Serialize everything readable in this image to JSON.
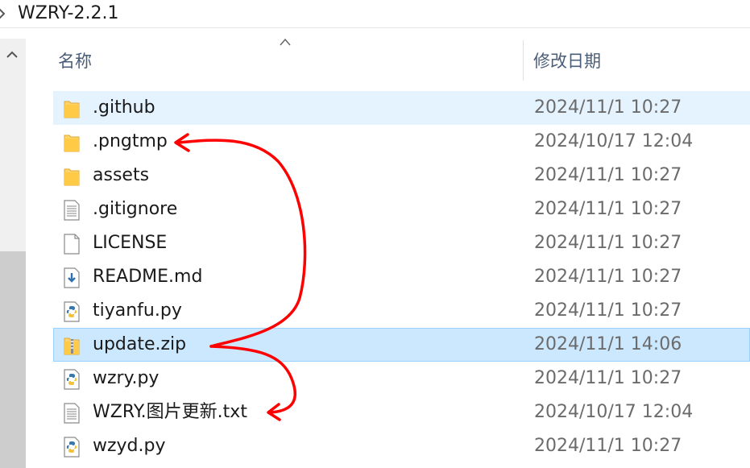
{
  "breadcrumb": {
    "folder": "WZRY-2.2.1"
  },
  "columns": {
    "name": "名称",
    "date_modified": "修改日期",
    "sort": "ascending"
  },
  "rows": [
    {
      "name": ".github",
      "date": "2024/11/1 10:27",
      "icon": "folder-icon",
      "state": "hover"
    },
    {
      "name": ".pngtmp",
      "date": "2024/10/17 12:04",
      "icon": "folder-icon",
      "state": ""
    },
    {
      "name": "assets",
      "date": "2024/11/1 10:27",
      "icon": "folder-icon",
      "state": ""
    },
    {
      "name": ".gitignore",
      "date": "2024/11/1 10:27",
      "icon": "text-file-icon",
      "state": ""
    },
    {
      "name": "LICENSE",
      "date": "2024/11/1 10:27",
      "icon": "blank-file-icon",
      "state": ""
    },
    {
      "name": "README.md",
      "date": "2024/11/1 10:27",
      "icon": "markdown-file-icon",
      "state": ""
    },
    {
      "name": "tiyanfu.py",
      "date": "2024/11/1 10:27",
      "icon": "python-file-icon",
      "state": ""
    },
    {
      "name": "update.zip",
      "date": "2024/11/1 14:06",
      "icon": "zip-folder-icon",
      "state": "selected"
    },
    {
      "name": "wzry.py",
      "date": "2024/11/1 10:27",
      "icon": "python-file-icon",
      "state": ""
    },
    {
      "name": "WZRY.图片更新.txt",
      "date": "2024/10/17 12:04",
      "icon": "text-file-icon",
      "state": ""
    },
    {
      "name": "wzyd.py",
      "date": "2024/11/1 10:27",
      "icon": "python-file-icon",
      "state": ""
    }
  ],
  "colors": {
    "accent_selected": "#cce8ff",
    "selected_border": "#99d1ff",
    "hover": "#e5f3ff",
    "annotation": "#ff0000",
    "folder": "#ffd36b"
  }
}
